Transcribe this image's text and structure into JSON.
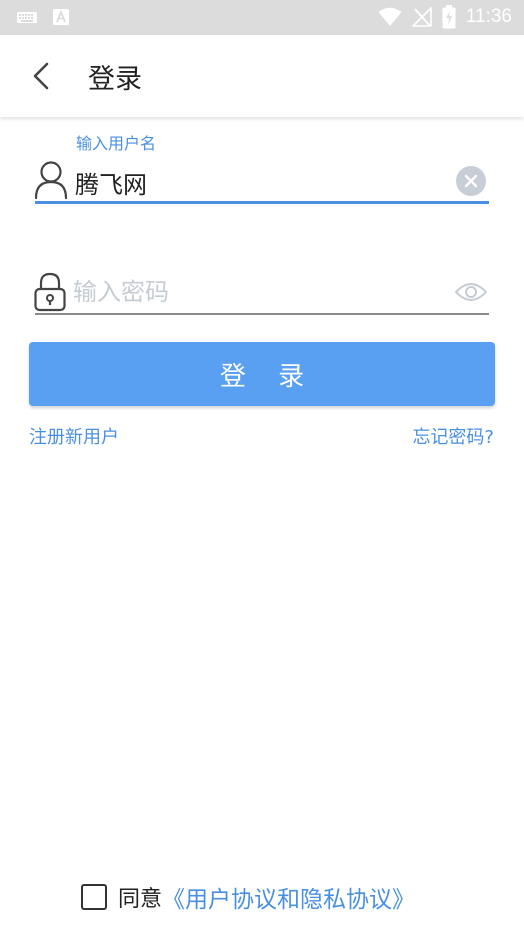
{
  "status_bar": {
    "time": "11:36",
    "icons": [
      "keyboard-icon",
      "a-notification-icon",
      "wifi-icon",
      "no-signal-icon",
      "battery-charging-icon"
    ]
  },
  "header": {
    "title": "登录",
    "back_icon": "chevron-left-icon"
  },
  "form": {
    "username": {
      "label": "输入用户名",
      "value": "腾飞网",
      "icon": "user-icon"
    },
    "password": {
      "placeholder": "输入密码",
      "icon": "lock-icon",
      "toggle_icon": "eye-icon"
    },
    "submit_label": "登 录"
  },
  "links": {
    "register": "注册新用户",
    "forgot": "忘记密码?"
  },
  "agreement": {
    "prefix": "同意",
    "link_text": "《用户协议和隐私协议》",
    "checked": false
  },
  "colors": {
    "accent": "#4a90e2",
    "button": "#5aa0f2",
    "status_bar": "#dcdcdc"
  }
}
